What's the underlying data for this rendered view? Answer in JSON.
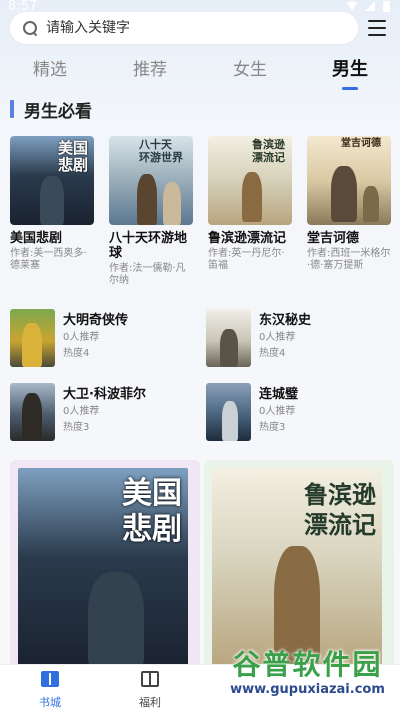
{
  "status_bar": {
    "time": "8:57"
  },
  "search": {
    "placeholder": "请输入关键字"
  },
  "tabs": [
    {
      "label": "精选"
    },
    {
      "label": "推荐"
    },
    {
      "label": "女生"
    },
    {
      "label": "男生"
    }
  ],
  "active_tab": "男生",
  "section": {
    "title": "男生必看"
  },
  "featured": [
    {
      "name": "美国悲剧",
      "author": "作者:美一西奥多·德莱塞",
      "cover_text": "美国悲剧"
    },
    {
      "name": "八十天环游地球",
      "author": "作者:法一儒勒·凡尔纳",
      "cover_text": "八十天\n环游世界"
    },
    {
      "name": "鲁滨逊漂流记",
      "author": "作者:英一丹尼尔·笛福",
      "cover_text": "鲁滨逊\n漂流记"
    },
    {
      "name": "堂吉诃德",
      "author": "作者:西班一米格尔·德·塞万提斯",
      "cover_text": "堂吉诃德"
    }
  ],
  "list": [
    {
      "name": "大明奇侠传",
      "recommend": "0人推荐",
      "heat": "热度4"
    },
    {
      "name": "东汉秘史",
      "recommend": "0人推荐",
      "heat": "热度4"
    },
    {
      "name": "大卫·科波菲尔",
      "recommend": "0人推荐",
      "heat": "热度3"
    },
    {
      "name": "连城璧",
      "recommend": "0人推荐",
      "heat": "热度3"
    }
  ],
  "big_covers": [
    {
      "cover_text": "美国\n悲剧"
    },
    {
      "cover_text": "鲁滨逊\n漂流记"
    }
  ],
  "bottom_nav": [
    {
      "label": "书城",
      "icon": "book-icon",
      "active": true
    },
    {
      "label": "福利",
      "icon": "gift-icon",
      "active": false
    }
  ],
  "watermark": {
    "title": "谷普软件园",
    "url": "www.gupuxiazai.com"
  },
  "colors": {
    "accent": "#2f6fe0",
    "section_bar": "#5b7ee5"
  }
}
